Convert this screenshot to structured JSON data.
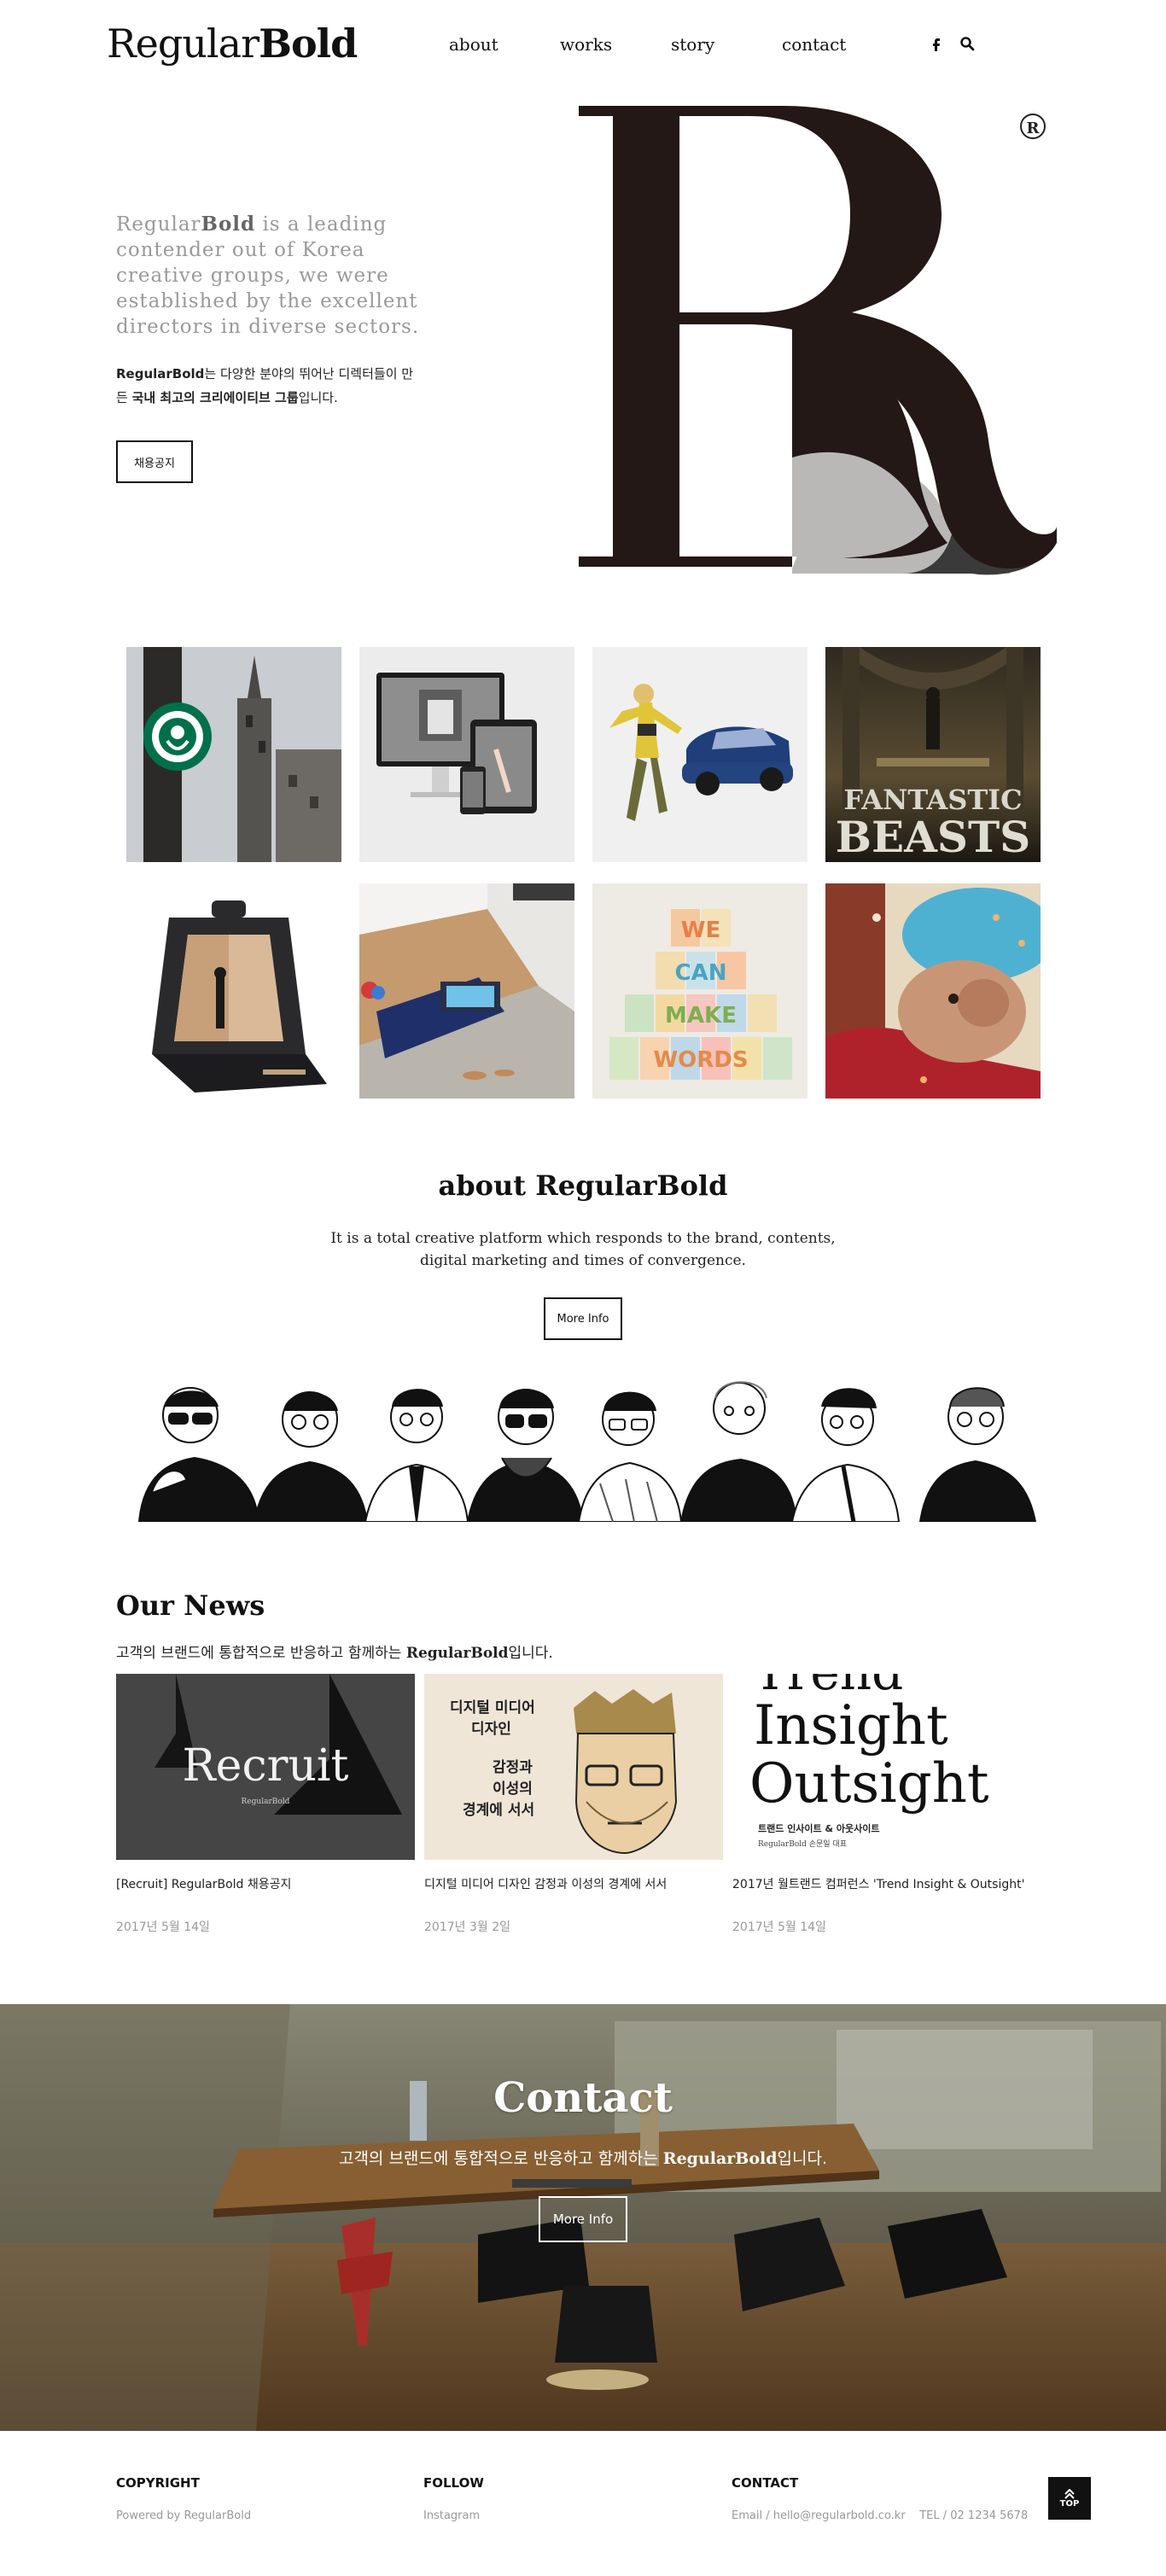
{
  "header": {
    "logo_regular": "Regular",
    "logo_bold": "Bold",
    "nav": [
      "about",
      "works",
      "story",
      "contact"
    ],
    "icons": [
      "facebook-icon",
      "search-icon"
    ]
  },
  "hero": {
    "lead_regular": "Regular",
    "lead_bold": "Bold",
    "lead_rest": " is a leading contender out of Korea creative groups, we were established by the excellent directors in diverse sectors.",
    "kor_brand": "RegularBold",
    "kor_text_1": "는 다양한 분야의 뛰어난 디렉터들이 만든 ",
    "kor_bold": "국내 최고의 크리에이티브 그룹",
    "kor_text_2": "입니다.",
    "button": "채용공지",
    "registered_mark": "R"
  },
  "works": {
    "items": [
      "starbucks",
      "devices",
      "superhero-car",
      "fantastic-beasts",
      "product-box",
      "gallery",
      "we-can-make-words",
      "illustration"
    ],
    "beasts_title_1": "FANTASTIC",
    "beasts_title_2": "BEASTS",
    "words": [
      "WE",
      "CAN",
      "MAKE",
      "WORDS"
    ]
  },
  "about": {
    "title_regular": "about Regular",
    "title_bold": "Bold",
    "description": "It is a total creative platform which responds to the brand, contents, digital marketing and times of convergence.",
    "button": "More Info"
  },
  "news": {
    "title": "Our News",
    "sub_1": "고객의 브랜드에 통합적으로 반응하고 함께하는 ",
    "sub_brand": "RegularBold",
    "sub_2": "입니다.",
    "cards": [
      {
        "title": "[Recruit] RegularBold 채용공지",
        "date": "2017년 5월 14일",
        "image_text": "Recruit",
        "image_brand": "RegularBold"
      },
      {
        "title": "디지털 미디어 디자인 감정과 이성의 경계에 서서",
        "date": "2017년 3월 2일",
        "image_lines": [
          "디지털 미디어",
          "디자인",
          "감정과",
          "이성의",
          "경계에 서서"
        ]
      },
      {
        "title": "2017년 월트랜드 컴퍼런스 'Trend Insight & Outsight'",
        "date": "2017년 5월 14일",
        "image_lines": [
          "Trend",
          "Insight",
          "Outsight"
        ],
        "image_caption": "트랜드 인사이트 & 아웃사이트",
        "image_brand": "RegularBold 손문일 대표"
      }
    ]
  },
  "contact": {
    "title": "Contact",
    "sub_1": "고객의 브랜드에 통합적으로 반응하고 함께하는 ",
    "sub_brand": "RegularBold",
    "sub_2": "입니다.",
    "button": "More Info"
  },
  "footer": {
    "copyright_title": "COPYRIGHT",
    "copyright_text": "Powered by RegularBold",
    "follow_title": "FOLLOW",
    "follow_link": "Instagram",
    "contact_title": "CONTACT",
    "contact_text": "Email / hello@regularbold.co.kr    TEL / 02 1234 5678",
    "top_label": "TOP"
  }
}
